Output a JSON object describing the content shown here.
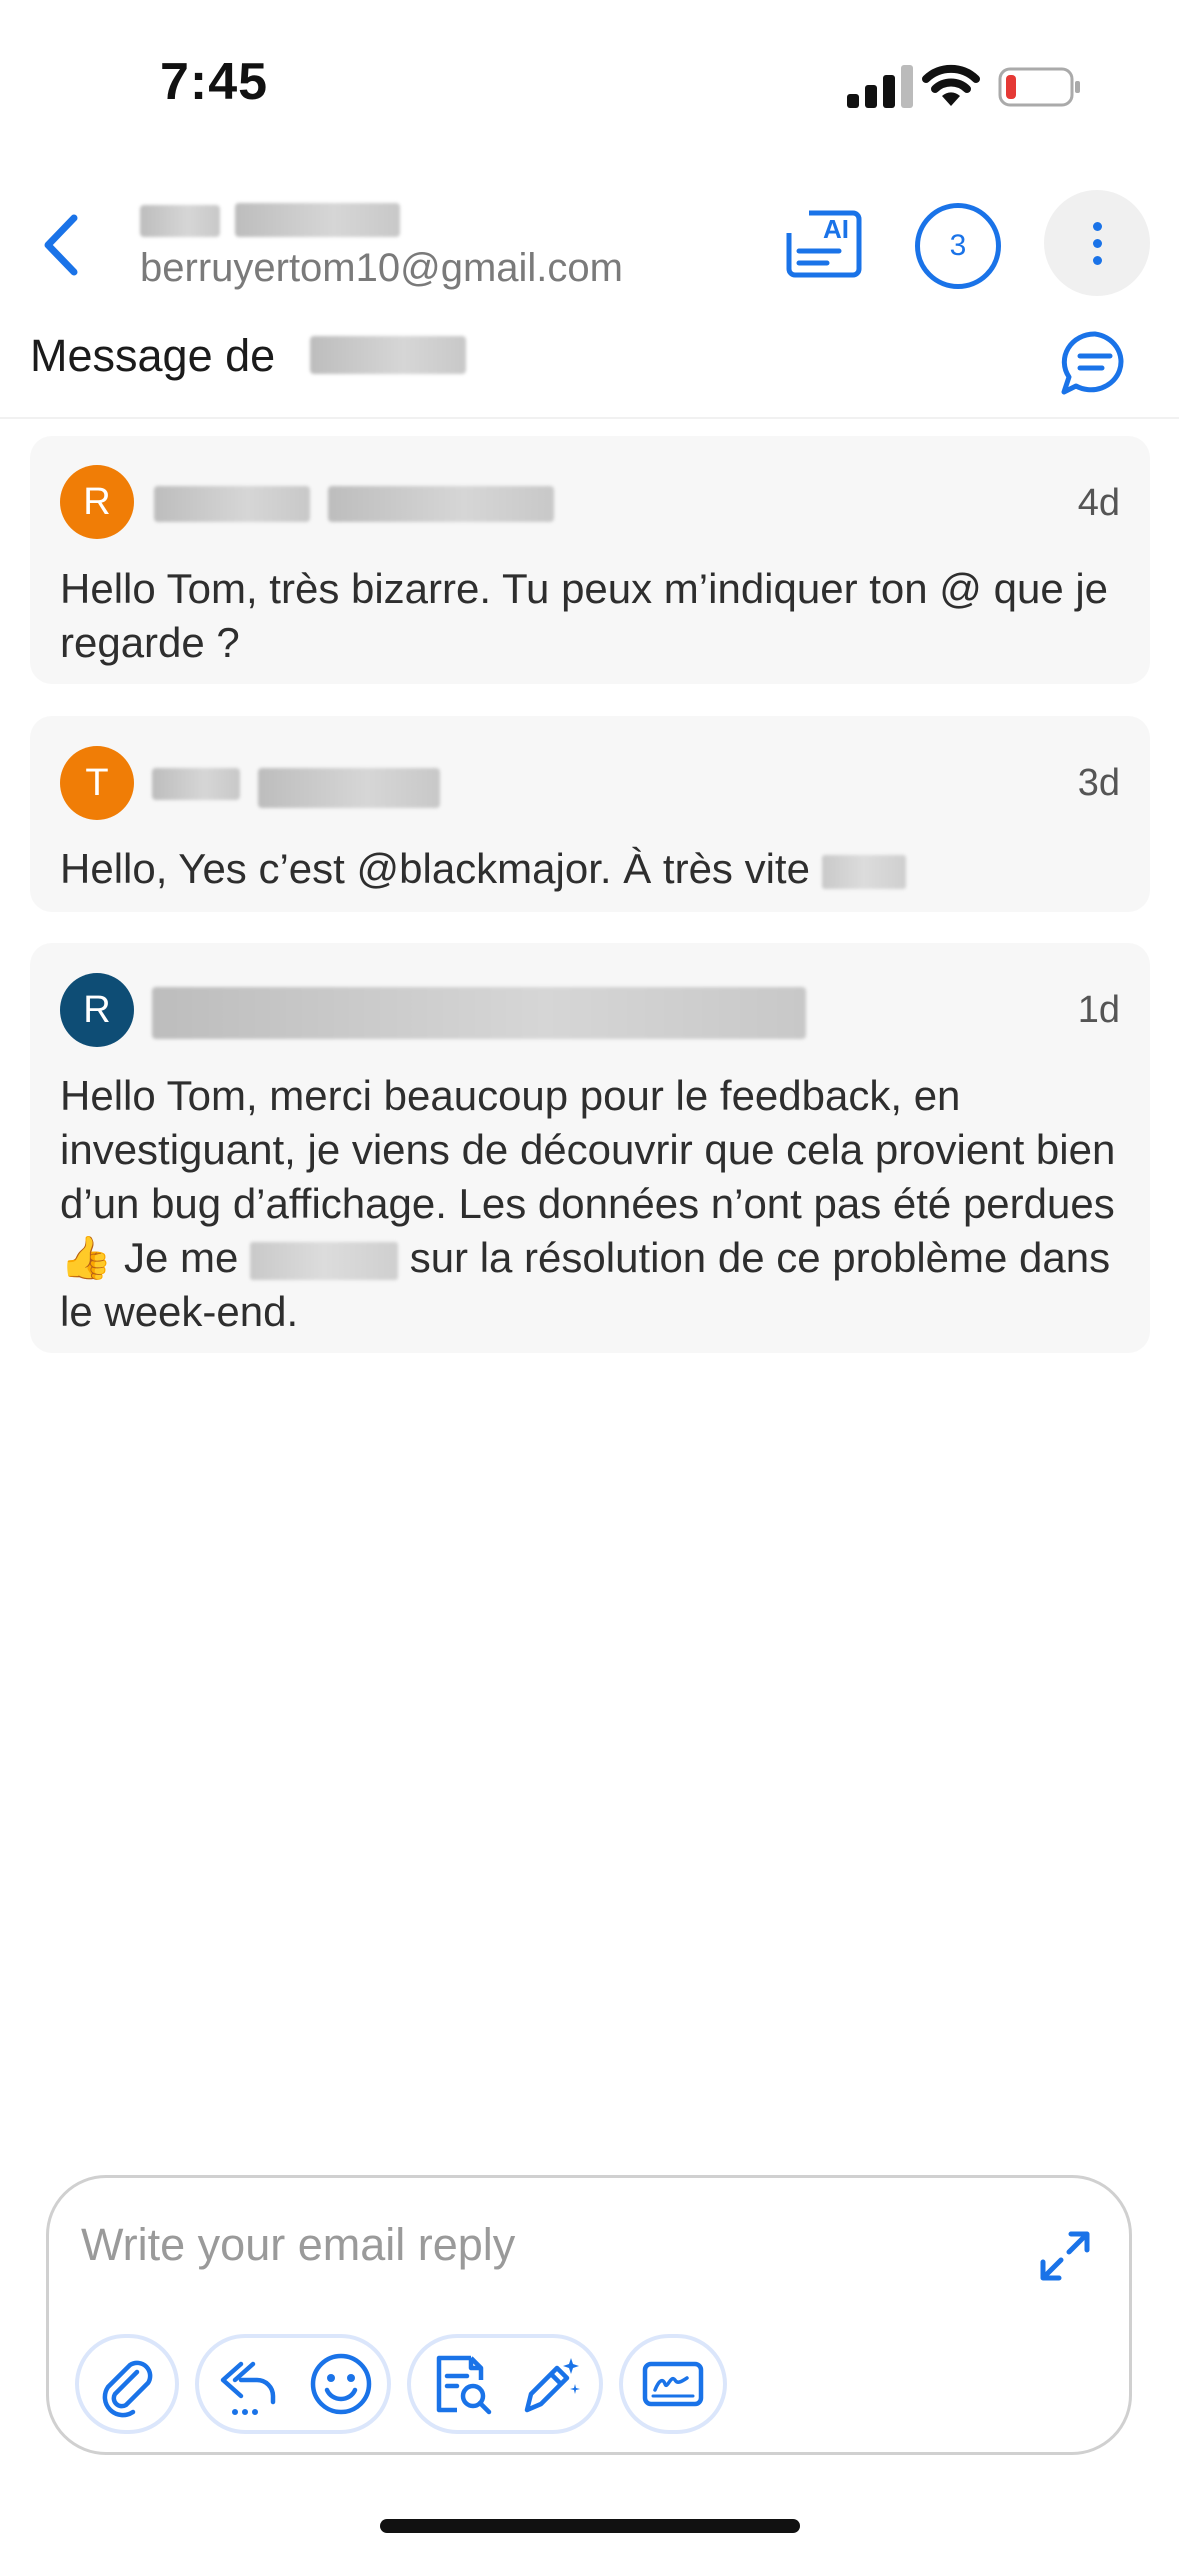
{
  "status_bar": {
    "time": "7:45"
  },
  "header": {
    "email": "berruyertom10@gmail.com",
    "unread_count": "3",
    "ai_label": "AI"
  },
  "subject": {
    "prefix": "Message de"
  },
  "messages": [
    {
      "initial": "R",
      "avatar_color": "#f07d06",
      "time": "4d",
      "body": "Hello Tom, très bizarre. Tu peux m’indiquer ton @ que je regarde ?"
    },
    {
      "initial": "T",
      "avatar_color": "#f07d06",
      "time": "3d",
      "body": "Hello, Yes c’est @blackmajor. À très vite"
    },
    {
      "initial": "R",
      "avatar_color": "#0e4d75",
      "time": "1d",
      "body_part1": "Hello Tom, merci beaucoup pour le feedback, en investiguant, je viens de découvrir que cela provient bien d’un bug d’affichage. Les données n’ont pas été perdues",
      "emoji": "👍",
      "body_part2": "Je me",
      "body_part3": "sur la résolution de ce problème dans le week-end."
    }
  ],
  "compose": {
    "placeholder": "Write your email reply"
  },
  "colors": {
    "accent": "#1a73e8",
    "orange_avatar": "#f07d06",
    "navy_avatar": "#0e4d75"
  },
  "icons": [
    "back-icon",
    "ai-summary-icon",
    "count-badge",
    "more-icon",
    "thread-icon",
    "expand-icon",
    "attach-icon",
    "reply-all-icon",
    "emoji-icon",
    "doc-search-icon",
    "magic-pen-icon",
    "signature-icon"
  ]
}
